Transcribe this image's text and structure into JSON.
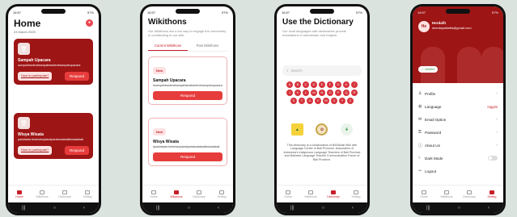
{
  "status": {
    "time": "16:57",
    "battery": "57%"
  },
  "nav": {
    "home": "Home",
    "wikithons": "Wikithons",
    "dictionary": "Dictionary",
    "setting": "Setting"
  },
  "home": {
    "title": "Home",
    "date": "23 March 2025",
    "cards": [
      {
        "title": "Sampah Upacara",
        "tags": "sampahbanten#sampahbanten#sampahupacara",
        "how": "How to participate?",
        "respond": "Respond"
      },
      {
        "title": "Wisya Wisata",
        "tags": "pariwisata bedeslanjutan#pariwisatabali#wisatabali",
        "how": "How to participate?",
        "respond": "Respond"
      }
    ]
  },
  "wikithons": {
    "title": "Wikithons",
    "desc": "Our Wikithons are a fun way to engage the community in contributing to our wiki.",
    "tab_current": "Current Wikithons",
    "tab_past": "Past Wikithons",
    "cards": [
      {
        "badge": "New",
        "title": "Sampah Upacara",
        "tags": "#sampahbanten#sampahsisabanten#sampahupacara",
        "button": "Respond"
      },
      {
        "badge": "New",
        "title": "Wisya Wisata",
        "tags": "#pariwisata berkelanjutan#pariwisatabali#wisatabali",
        "button": "Respond"
      }
    ]
  },
  "dictionary": {
    "title": "Use the Dictionary",
    "desc": "Our local languages wiki dictionaries provide translations in Indonesian and English.",
    "search_placeholder": "Search",
    "letters": [
      "A",
      "B",
      "C",
      "D",
      "E",
      "F",
      "G",
      "H",
      "I",
      "J",
      "K",
      "L",
      "M",
      "N",
      "O",
      "P",
      "Q",
      "R",
      "S",
      "T",
      "U",
      "V",
      "W",
      "X",
      "Y",
      "Z"
    ],
    "about": "This dictionary is a collaboration of BASAbali Wiki with Language Center of Bali Province, Association of Indonesia's Indigenous Language Teachers of Bali Province and Balinese Language Teacher Communication Forum of Bali Province."
  },
  "settings": {
    "avatar_initials": "He",
    "name": "Herdafit",
    "email": "sherdayatiarfla@gmail.com",
    "verified": "Verified",
    "items": [
      {
        "icon": "user-icon",
        "glyph": "♙",
        "label": "Profile",
        "value": ""
      },
      {
        "icon": "language-icon",
        "glyph": "◍",
        "label": "Language",
        "value": "Inggris"
      },
      {
        "icon": "email-icon",
        "glyph": "✉",
        "label": "Email Option",
        "value": ""
      },
      {
        "icon": "key-icon",
        "glyph": "⚿",
        "label": "Password",
        "value": ""
      },
      {
        "icon": "info-icon",
        "glyph": "ⓘ",
        "label": "About Us",
        "value": ""
      },
      {
        "icon": "moon-icon",
        "glyph": "☾",
        "label": "Dark Mode",
        "value": ""
      },
      {
        "icon": "logout-icon",
        "glyph": "⇦",
        "label": "Logout",
        "value": ""
      }
    ]
  },
  "colors": {
    "primary": "#c8202a",
    "card_dark": "#9e1515",
    "button": "#e73c3c"
  }
}
